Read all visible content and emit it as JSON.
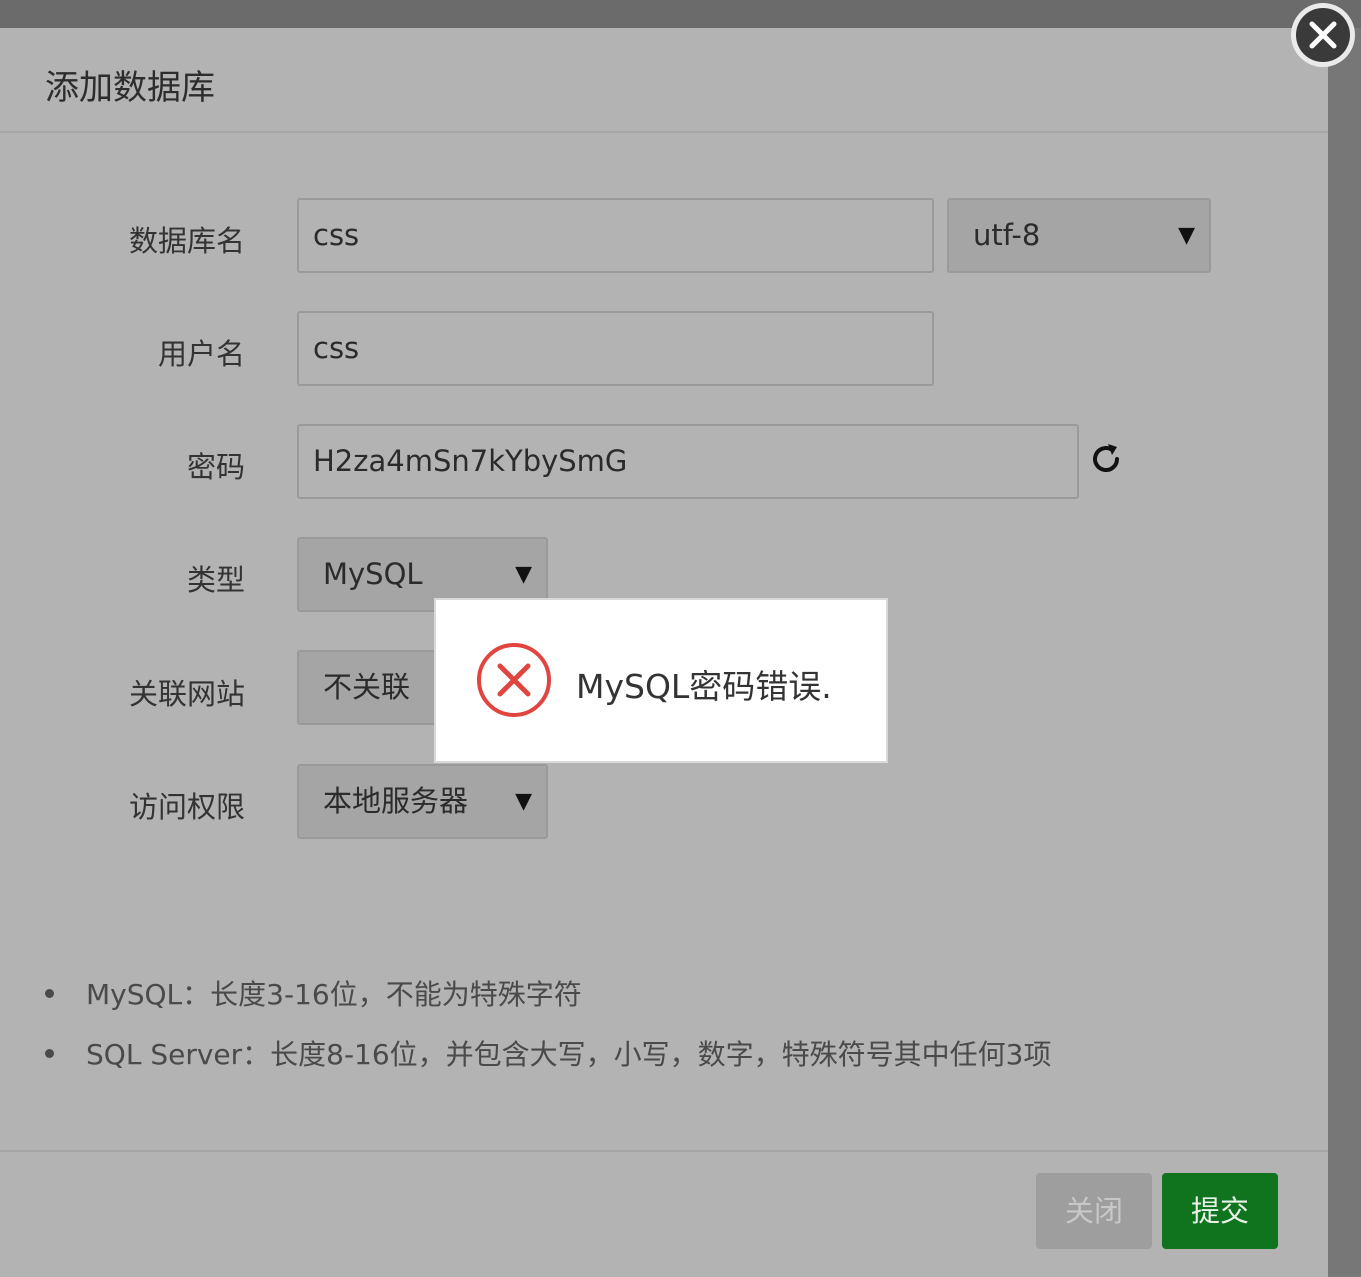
{
  "dialog": {
    "title": "添加数据库"
  },
  "form": {
    "db_name": {
      "label": "数据库名",
      "value": "css",
      "charset": "utf-8"
    },
    "username": {
      "label": "用户名",
      "value": "css"
    },
    "password": {
      "label": "密码",
      "value": "H2za4mSn7kYbySmG"
    },
    "type": {
      "label": "类型",
      "selected": "MySQL"
    },
    "linked_site": {
      "label": "关联网站",
      "selected": "不关联"
    },
    "access": {
      "label": "访问权限",
      "selected": "本地服务器"
    }
  },
  "tips": [
    "MySQL：长度3-16位，不能为特殊字符",
    "SQL Server：长度8-16位，并包含大写，小写，数字，特殊符号其中任何3项"
  ],
  "footer": {
    "close_label": "关闭",
    "submit_label": "提交"
  },
  "toast": {
    "message": "MySQL密码错误.",
    "icon": "error-icon",
    "accent": "#e0453f"
  },
  "icons": {
    "refresh": "refresh-icon",
    "close": "close-icon",
    "caret": "▼"
  }
}
